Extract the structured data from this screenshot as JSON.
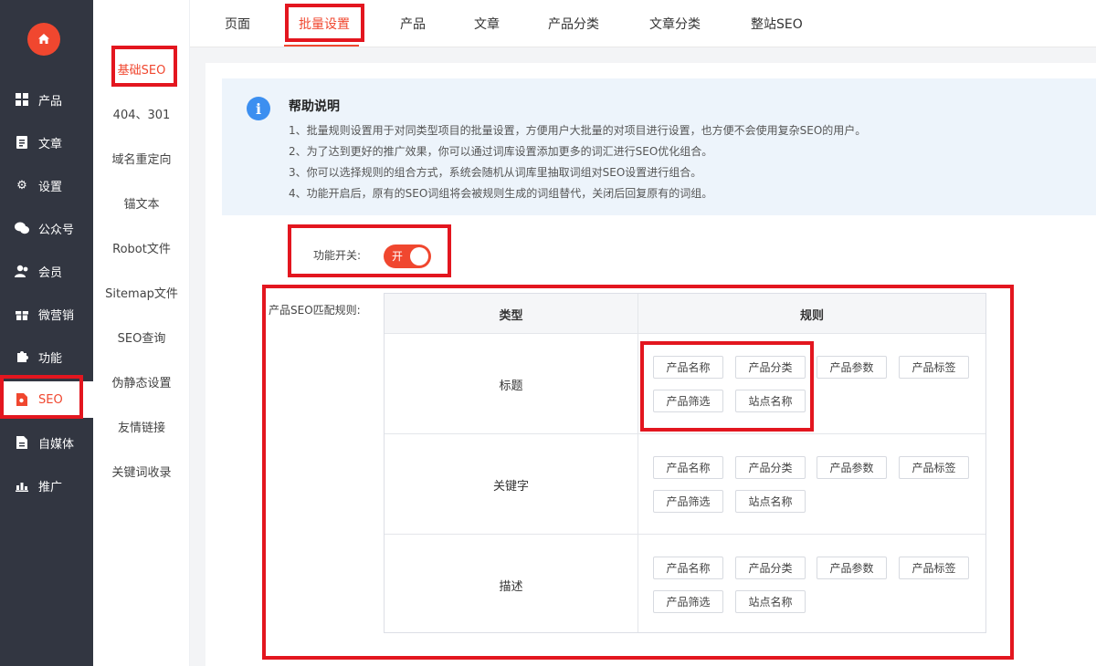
{
  "sidebar": {
    "items": [
      {
        "label": "产品",
        "icon": "grid-icon"
      },
      {
        "label": "文章",
        "icon": "document-icon"
      },
      {
        "label": "设置",
        "icon": "gear-icon"
      },
      {
        "label": "公众号",
        "icon": "wechat-icon"
      },
      {
        "label": "会员",
        "icon": "members-icon"
      },
      {
        "label": "微营销",
        "icon": "gift-icon"
      },
      {
        "label": "功能",
        "icon": "puzzle-icon"
      },
      {
        "label": "SEO",
        "icon": "seo-file-icon"
      },
      {
        "label": "自媒体",
        "icon": "file-icon"
      },
      {
        "label": "推广",
        "icon": "chart-icon"
      }
    ],
    "active": "SEO"
  },
  "subnav": {
    "items": [
      "基础SEO",
      "404、301",
      "域名重定向",
      "锚文本",
      "Robot文件",
      "Sitemap文件",
      "SEO查询",
      "伪静态设置",
      "友情链接",
      "关键词收录"
    ],
    "active": "基础SEO"
  },
  "tabs": {
    "items": [
      "页面",
      "批量设置",
      "产品",
      "文章",
      "产品分类",
      "文章分类",
      "整站SEO"
    ],
    "active": "批量设置"
  },
  "help": {
    "title": "帮助说明",
    "lines": [
      "1、批量规则设置用于对同类型项目的批量设置，方便用户大批量的对项目进行设置，也方便不会使用复杂SEO的用户。",
      "2、为了达到更好的推广效果，你可以通过词库设置添加更多的词汇进行SEO优化组合。",
      "3、你可以选择规则的组合方式，系统会随机从词库里抽取词组对SEO设置进行组合。",
      "4、功能开启后，原有的SEO词组将会被规则生成的词组替代，关闭后回复原有的词组。"
    ]
  },
  "switch": {
    "label": "功能开关:",
    "state": "开"
  },
  "rules": {
    "label": "产品SEO匹配规则:",
    "headers": {
      "type": "类型",
      "rule": "规则"
    },
    "rows": [
      {
        "type": "标题",
        "tags": [
          "产品名称",
          "产品分类",
          "产品参数",
          "产品标签",
          "产品筛选",
          "站点名称"
        ]
      },
      {
        "type": "关键字",
        "tags": [
          "产品名称",
          "产品分类",
          "产品参数",
          "产品标签",
          "产品筛选",
          "站点名称"
        ]
      },
      {
        "type": "描述",
        "tags": [
          "产品名称",
          "产品分类",
          "产品参数",
          "产品标签",
          "产品筛选",
          "站点名称"
        ]
      }
    ]
  },
  "colors": {
    "accent": "#f0472f",
    "sidebar_bg": "#323641",
    "annotation": "#e3161f",
    "info": "#3c8ff0"
  }
}
